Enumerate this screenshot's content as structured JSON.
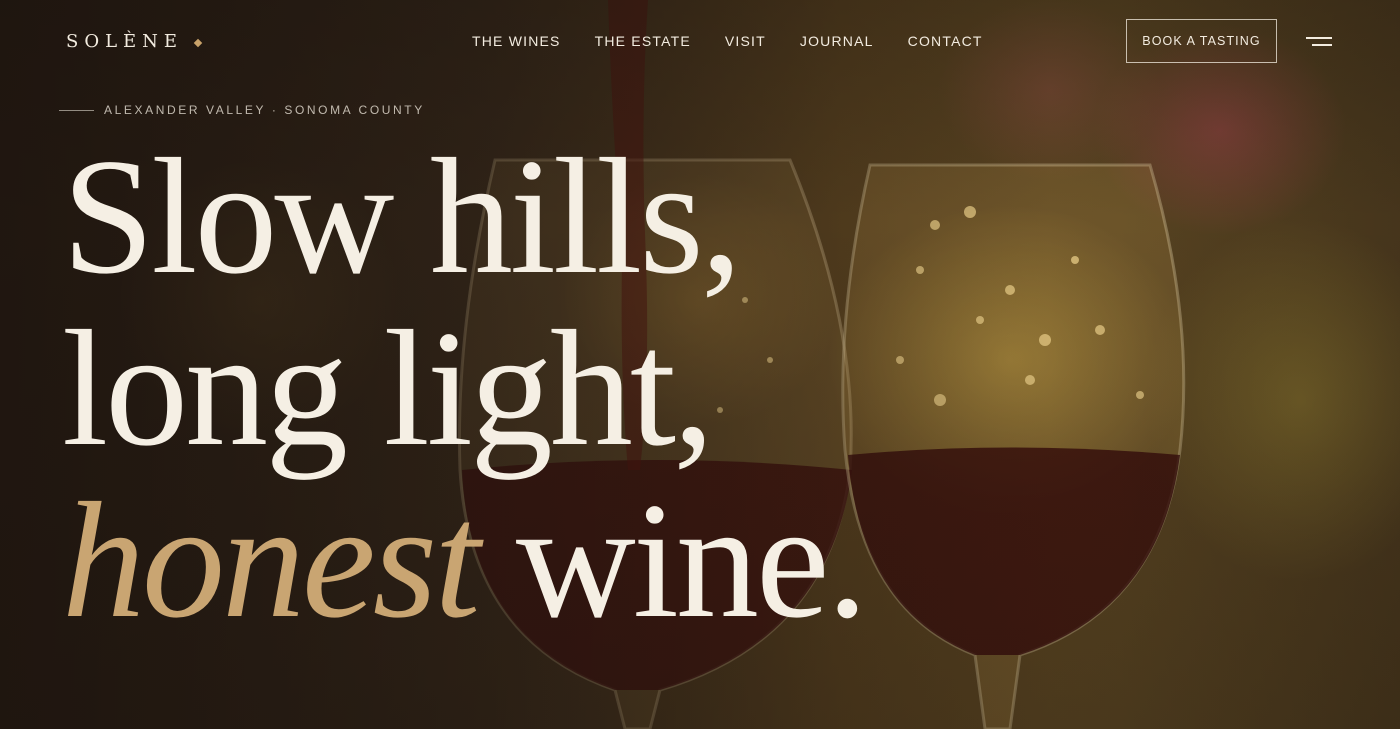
{
  "brand": {
    "name": "SOLÈNE",
    "accent_color": "#c9a26a"
  },
  "nav": {
    "items": [
      {
        "label": "THE WINES"
      },
      {
        "label": "THE ESTATE"
      },
      {
        "label": "VISIT"
      },
      {
        "label": "JOURNAL"
      },
      {
        "label": "CONTACT"
      }
    ],
    "cta_label": "BOOK A TASTING",
    "menu_icon": "hamburger-menu-icon"
  },
  "hero": {
    "eyebrow": "ALEXANDER VALLEY · SONOMA COUNTY",
    "headline_line1": "Slow hills,",
    "headline_line2": "long light,",
    "headline_accent": "honest",
    "headline_line3_rest": "wine.",
    "headline_color": "#f5efe4",
    "accent_color": "#c9a572",
    "background_image": "two-wine-glasses-red-wine-pour-bokeh"
  }
}
